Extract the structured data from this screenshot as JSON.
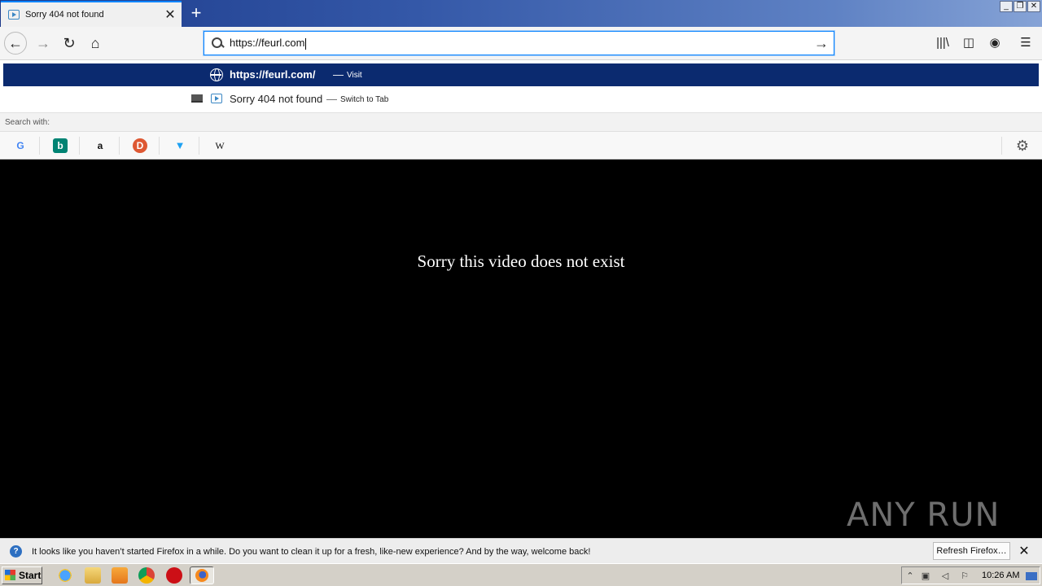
{
  "browser": {
    "tab": {
      "title": "Sorry 404 not found"
    },
    "new_tab_label": "+",
    "window_controls": {
      "minimize": "_",
      "restore": "❐",
      "close": "✕"
    }
  },
  "navbar": {
    "url_value": "https://feurl.com",
    "icons": [
      "back-icon",
      "forward-icon",
      "reload-icon",
      "home-icon",
      "search-icon",
      "go-arrow-icon",
      "library-icon",
      "sidebar-icon",
      "account-icon",
      "menu-icon"
    ]
  },
  "dropdown": {
    "visit_row": {
      "url": "https://feurl.com/",
      "separator": "—",
      "action": "Visit"
    },
    "tab_row": {
      "title": "Sorry 404 not found",
      "separator": "—",
      "action": "Switch to Tab"
    },
    "search_with_label": "Search with:",
    "engines": [
      {
        "name": "google",
        "glyph": "G",
        "color": "#4285f4"
      },
      {
        "name": "bing",
        "glyph": "b",
        "color": "#ffffff",
        "bg": "#008373"
      },
      {
        "name": "amazon",
        "glyph": "a",
        "color": "#111111"
      },
      {
        "name": "duckduckgo",
        "glyph": "D",
        "color": "#ffffff",
        "bg": "#de5833"
      },
      {
        "name": "twitter",
        "glyph": "🐦",
        "color": "#1da1f2"
      },
      {
        "name": "wikipedia",
        "glyph": "W",
        "color": "#111111"
      }
    ]
  },
  "content": {
    "message": "Sorry this video does not exist",
    "watermark": "ANY RUN"
  },
  "notification": {
    "text": "It looks like you haven’t started Firefox in a while. Do you want to clean it up for a fresh, like-new experience? And by the way, welcome back!",
    "button": "Refresh Firefox…",
    "close": "✕"
  },
  "taskbar": {
    "start_label": "Start",
    "clock": "10:26 AM"
  }
}
